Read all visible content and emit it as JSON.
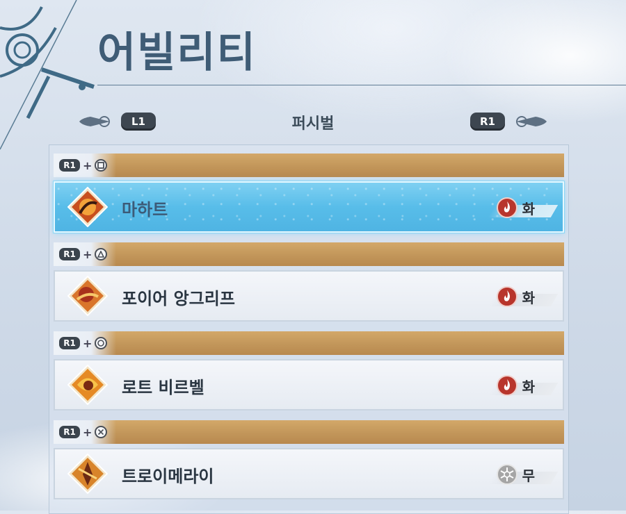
{
  "header": {
    "title": "어빌리티"
  },
  "nav": {
    "left_button": "L1",
    "right_button": "R1",
    "current_tab": "퍼시벌"
  },
  "groups": [
    {
      "combo": {
        "modifier": "R1",
        "plus": "+",
        "face_button": "square-icon"
      },
      "ability": {
        "name": "마하트",
        "element_icon": "fire-icon",
        "element_label": "화"
      }
    },
    {
      "combo": {
        "modifier": "R1",
        "plus": "+",
        "face_button": "triangle-icon"
      },
      "ability": {
        "name": "포이어 앙그리프",
        "element_icon": "fire-icon",
        "element_label": "화"
      }
    },
    {
      "combo": {
        "modifier": "R1",
        "plus": "+",
        "face_button": "circle-icon"
      },
      "ability": {
        "name": "로트 비르벨",
        "element_icon": "fire-icon",
        "element_label": "화"
      }
    },
    {
      "combo": {
        "modifier": "R1",
        "plus": "+",
        "face_button": "cross-icon"
      },
      "ability": {
        "name": "트로이메라이",
        "element_icon": "null-element-icon",
        "element_label": "무"
      }
    }
  ],
  "colors": {
    "accent": "#5bbfe9",
    "header_bar": "#c79b5e",
    "title": "#3f5c76",
    "fire": "#b8352c",
    "neutral": "#9a9a9a"
  }
}
